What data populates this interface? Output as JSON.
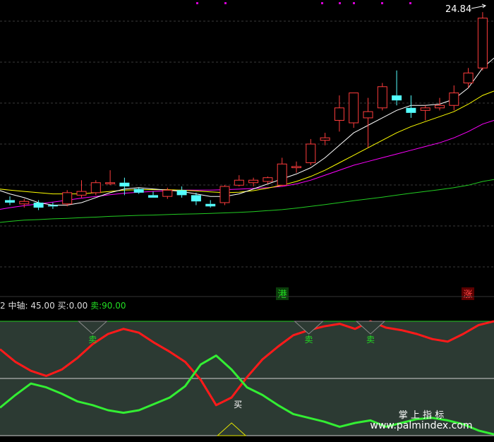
{
  "header": {
    "top_dots_color": "#d400d4"
  },
  "price_label": "24.84",
  "top_markers": [
    {
      "text": "港",
      "color": "#22dd22",
      "bg": "#0b3d0b",
      "index": 19
    },
    {
      "text": "涨",
      "color": "#ff4444",
      "bg": "#5a0000",
      "index": 32
    }
  ],
  "legend": {
    "prefix": "2",
    "axis_label": "中轴:",
    "axis_value": "45.00",
    "buy_label": "买:",
    "buy_value": "0.00",
    "sell_label": "卖:",
    "sell_value": "90.00"
  },
  "signals": [
    {
      "text": "卖",
      "kind": "sell",
      "index": 6
    },
    {
      "text": "卖",
      "kind": "sell",
      "index": 20
    },
    {
      "text": "卖",
      "kind": "sell",
      "index": 24
    },
    {
      "text": "买",
      "kind": "buy",
      "index": 15
    }
  ],
  "watermark": {
    "line1": "掌 上 指 标",
    "line2": "www.palmindex.com"
  },
  "colors": {
    "up": "#ff3c3c",
    "down": "#54ffff",
    "ma_short": "#ffffff",
    "ma_mid": "#ffff00",
    "ma_long": "#ff00ff",
    "ma_longest": "#22cc22",
    "osc_red": "#ff1a1a",
    "osc_green": "#33ee33"
  },
  "chart_data": [
    {
      "type": "candlestick",
      "ylim": [
        14.0,
        25.1
      ],
      "ohlc": [
        [
          17.3,
          17.45,
          17.1,
          17.2
        ],
        [
          17.15,
          17.35,
          17.0,
          17.25
        ],
        [
          17.2,
          17.3,
          16.9,
          17.0
        ],
        [
          17.1,
          17.2,
          16.95,
          17.05
        ],
        [
          17.15,
          17.7,
          17.05,
          17.6
        ],
        [
          17.5,
          18.1,
          17.4,
          17.65
        ],
        [
          17.6,
          18.1,
          17.5,
          18.0
        ],
        [
          18.0,
          18.5,
          17.9,
          18.0
        ],
        [
          18.0,
          18.2,
          17.5,
          17.85
        ],
        [
          17.75,
          17.8,
          17.55,
          17.6
        ],
        [
          17.5,
          17.65,
          17.4,
          17.4
        ],
        [
          17.45,
          17.8,
          17.35,
          17.7
        ],
        [
          17.7,
          17.85,
          17.4,
          17.5
        ],
        [
          17.5,
          17.6,
          17.1,
          17.25
        ],
        [
          17.15,
          17.3,
          17.0,
          17.05
        ],
        [
          17.2,
          17.9,
          17.1,
          17.85
        ],
        [
          17.9,
          18.3,
          17.85,
          18.1
        ],
        [
          18.0,
          18.2,
          17.85,
          18.1
        ],
        [
          18.05,
          18.25,
          17.95,
          18.2
        ],
        [
          17.9,
          19.0,
          17.85,
          18.75
        ],
        [
          18.6,
          18.85,
          18.4,
          18.65
        ],
        [
          18.8,
          19.75,
          18.7,
          19.55
        ],
        [
          19.7,
          20.0,
          19.5,
          19.8
        ],
        [
          20.5,
          21.5,
          20.05,
          21.0
        ],
        [
          20.4,
          21.3,
          20.2,
          21.6
        ],
        [
          20.6,
          21.4,
          19.4,
          20.85
        ],
        [
          21.0,
          22.0,
          20.9,
          21.85
        ],
        [
          21.5,
          22.5,
          21.1,
          21.3
        ],
        [
          21.0,
          21.5,
          20.6,
          20.8
        ],
        [
          20.9,
          21.1,
          20.5,
          21.0
        ],
        [
          21.0,
          21.4,
          20.9,
          21.1
        ],
        [
          21.1,
          21.9,
          20.9,
          21.6
        ],
        [
          22.0,
          22.6,
          21.8,
          22.4
        ],
        [
          22.6,
          24.84,
          22.5,
          24.6
        ]
      ],
      "ma_short": [
        17.55,
        17.4,
        17.2,
        17.1,
        17.1,
        17.2,
        17.4,
        17.6,
        17.75,
        17.8,
        17.75,
        17.7,
        17.65,
        17.55,
        17.45,
        17.45,
        17.55,
        17.75,
        17.95,
        18.15,
        18.35,
        18.6,
        19.0,
        19.5,
        20.0,
        20.3,
        20.6,
        20.9,
        21.1,
        21.1,
        21.15,
        21.35,
        21.8,
        22.6
      ],
      "ma_mid": [
        17.7,
        17.65,
        17.6,
        17.55,
        17.55,
        17.55,
        17.6,
        17.65,
        17.7,
        17.72,
        17.72,
        17.72,
        17.7,
        17.67,
        17.63,
        17.6,
        17.62,
        17.68,
        17.78,
        17.9,
        18.05,
        18.25,
        18.5,
        18.8,
        19.1,
        19.4,
        19.7,
        20.0,
        20.25,
        20.45,
        20.65,
        20.85,
        21.15,
        21.5
      ],
      "ma_long": [
        17.0,
        17.08,
        17.15,
        17.22,
        17.3,
        17.38,
        17.45,
        17.52,
        17.58,
        17.62,
        17.65,
        17.68,
        17.7,
        17.7,
        17.7,
        17.72,
        17.74,
        17.77,
        17.8,
        17.85,
        17.95,
        18.1,
        18.3,
        18.5,
        18.7,
        18.85,
        19.0,
        19.15,
        19.3,
        19.45,
        19.6,
        19.8,
        20.05,
        20.35
      ],
      "ma_longest": [
        16.45,
        16.5,
        16.52,
        16.55,
        16.57,
        16.6,
        16.62,
        16.65,
        16.67,
        16.69,
        16.7,
        16.72,
        16.74,
        16.75,
        16.77,
        16.79,
        16.81,
        16.84,
        16.88,
        16.92,
        16.98,
        17.05,
        17.12,
        17.2,
        17.28,
        17.35,
        17.42,
        17.5,
        17.58,
        17.65,
        17.72,
        17.8,
        17.9,
        18.05
      ]
    },
    {
      "type": "line",
      "ylim": [
        0,
        90
      ],
      "reference_lines": [
        0,
        45,
        90
      ],
      "series": [
        {
          "values": [
            68,
            58,
            51,
            47,
            52,
            61,
            72,
            80,
            84,
            81,
            73,
            66,
            58,
            44,
            24,
            30,
            46,
            60,
            70,
            79,
            83,
            86,
            88,
            84,
            90,
            85,
            83,
            80,
            76,
            74,
            80,
            87,
            90
          ]
        },
        {
          "values": [
            22,
            32,
            41,
            38,
            33,
            27,
            24,
            20,
            18,
            20,
            25,
            30,
            39,
            56,
            63,
            52,
            38,
            32,
            24,
            17,
            14,
            11,
            7,
            10,
            12,
            7,
            10,
            13,
            14,
            12,
            9,
            4,
            1
          ]
        }
      ]
    }
  ]
}
